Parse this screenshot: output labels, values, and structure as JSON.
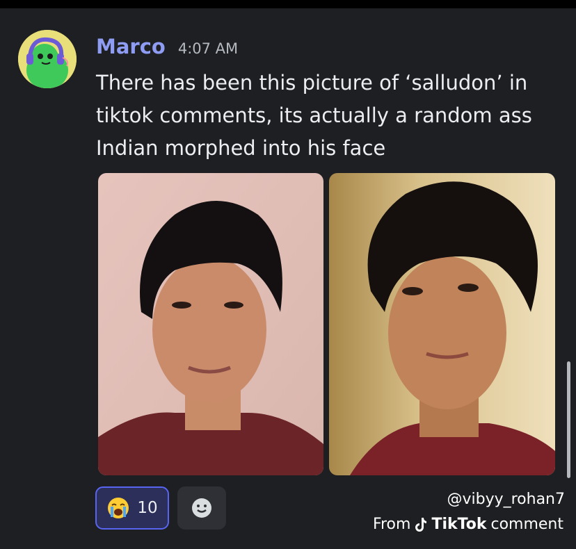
{
  "message": {
    "author": "Marco",
    "timestamp": "4:07 AM",
    "text": "There has been this picture of ‘salludon’ in tiktok comments, its actually a random ass Indian morphed into his face"
  },
  "attachments": [
    {
      "name": "photo-1"
    },
    {
      "name": "photo-2"
    }
  ],
  "reaction": {
    "emoji": "loudly-crying-face",
    "count": "10"
  },
  "add_reaction_icon": "smile-icon",
  "watermark": {
    "handle": "@vibyy_rohan7",
    "from": "From",
    "app": "TikTok",
    "suffix": "comment"
  },
  "colors": {
    "background": "#1e1f22",
    "username": "#8e9cf4",
    "reaction_border": "#5865f2"
  }
}
